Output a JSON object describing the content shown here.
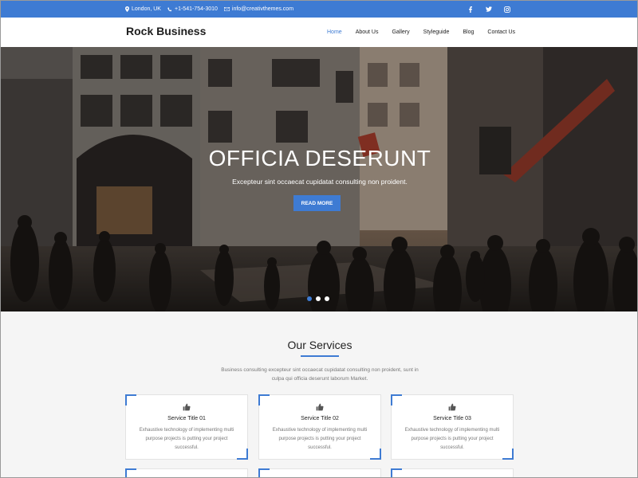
{
  "topbar": {
    "location": "London, UK",
    "phone": "+1-541-754-3010",
    "email": "info@creativthemes.com",
    "social": [
      "facebook-icon",
      "twitter-icon",
      "instagram-icon"
    ]
  },
  "header": {
    "brand": "Rock Business",
    "nav": [
      "Home",
      "About Us",
      "Gallery",
      "Styleguide",
      "Blog",
      "Contact Us"
    ],
    "active": "Home"
  },
  "hero": {
    "title": "OFFICIA DESERUNT",
    "subtitle": "Excepteur sint occaecat cupidatat consulting non proident.",
    "button": "READ MORE",
    "slides": 3,
    "active_slide": 1
  },
  "services": {
    "title": "Our Services",
    "description": "Business consulting excepteur sint occaecat cupidatat consulting non proident, sunt in culpa qui officia deserunt laborum Market.",
    "cards": [
      {
        "icon": "thumbs-up-icon",
        "title": "Service Title 01",
        "text": "Exhaustive technology of implementing multi purpose projects is putting your project successful."
      },
      {
        "icon": "thumbs-up-icon",
        "title": "Service Title 02",
        "text": "Exhaustive technology of implementing multi purpose projects is putting your project successful."
      },
      {
        "icon": "thumbs-up-icon",
        "title": "Service Title 03",
        "text": "Exhaustive technology of implementing multi purpose projects is putting your project successful."
      }
    ]
  },
  "colors": {
    "accent": "#3e7bd3",
    "topbar": "#3e7bd3",
    "services_bg": "#f5f5f5"
  }
}
